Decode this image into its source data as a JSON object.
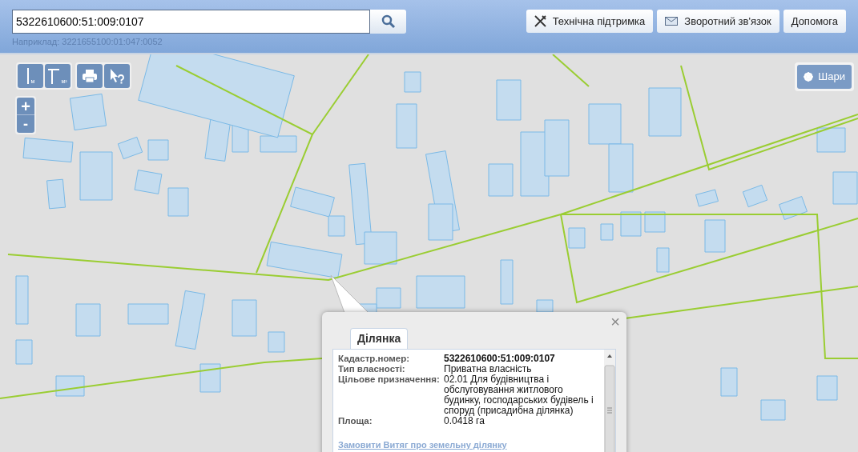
{
  "search": {
    "value": "5322610600:51:009:0107",
    "hint": "Наприклад: 3221655100:01:047:0052"
  },
  "header_buttons": [
    {
      "kind": "support",
      "label": "Технічна підтримка"
    },
    {
      "kind": "feedback",
      "label": "Зворотний зв'язок"
    },
    {
      "kind": "plain",
      "label": "Допомога"
    }
  ],
  "map_tools": [
    {
      "kind": "distance",
      "unit": "м"
    },
    {
      "kind": "area",
      "unit": "м²"
    },
    {
      "kind": "print"
    },
    {
      "kind": "identify"
    }
  ],
  "zoom": {
    "in": "+",
    "out": "-"
  },
  "layers_button": {
    "label": "Шари"
  },
  "popup": {
    "close": "×",
    "tabs": [
      {
        "label": "Ділянка",
        "selected": true
      }
    ],
    "rows": [
      {
        "label": "Кадастр.номер:",
        "value": "5322610600:51:009:0107",
        "bold": true
      },
      {
        "label": "Тип власності:",
        "value": "Приватна власність",
        "bold": false
      },
      {
        "label": "Цільове призначення:",
        "value": "02.01 Для будівництва і обслуговування житлового будинку, господарських будівель і споруд (присадибна ділянка)",
        "bold": false
      },
      {
        "label": "Площа:",
        "value": "0.0418 га",
        "bold": false
      }
    ],
    "link": "Замовити Витяг про земельну ділянку"
  }
}
